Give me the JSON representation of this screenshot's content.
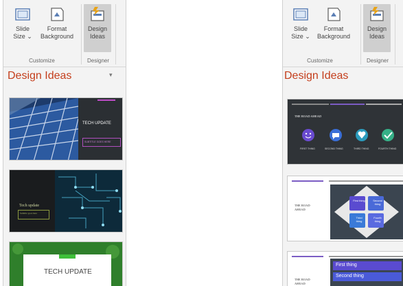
{
  "ribbon": {
    "slide_size": {
      "line1": "Slide",
      "line2": "Size ⌄"
    },
    "format_background": {
      "line1": "Format",
      "line2": "Background"
    },
    "design_ideas": {
      "line1": "Design",
      "line2": "Ideas"
    },
    "group_customize": "Customize",
    "group_designer": "Designer"
  },
  "pane": {
    "title": "Design Ideas",
    "dropdown_glyph": "▾"
  },
  "left_thumbs": {
    "t1": {
      "title": "TECH UPDATE",
      "subtitle": "SUBTITLE GOES HERE"
    },
    "t2": {
      "title": "Tech update",
      "subtitle": "Subtitle goes here"
    },
    "t3": {
      "title": "TECH UPDATE"
    }
  },
  "right_thumbs": {
    "r1": {
      "title": "THE ROAD AHEAD",
      "items": [
        "FIRST THING",
        "SECOND THING",
        "THIRD THING",
        "FOURTH THING"
      ]
    },
    "r2": {
      "title_l1": "THE ROAD",
      "title_l2": "AHEAD",
      "cells": [
        "First thing",
        "Second thing",
        "Third thing",
        "Fourth thing"
      ]
    },
    "r3": {
      "title_l1": "THE ROAD",
      "title_l2": "AHEAD",
      "rows": [
        "First thing",
        "Second thing"
      ]
    }
  },
  "colors": {
    "accent": "#c43e1c",
    "slide_dark": "#2f3337",
    "purple": "#7b5cc4",
    "blue": "#3a6fd8"
  }
}
